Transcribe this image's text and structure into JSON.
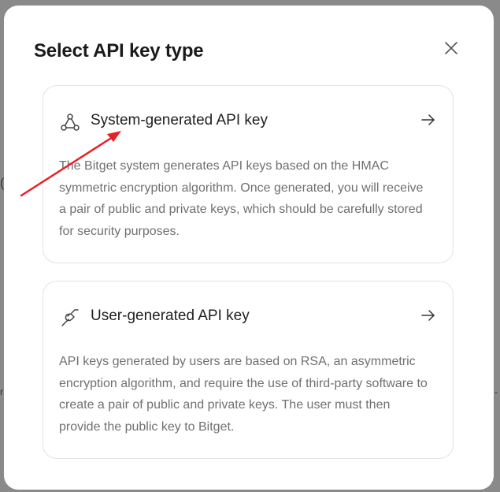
{
  "modal": {
    "title": "Select API key type"
  },
  "cards": [
    {
      "title": "System-generated API key",
      "description": "The Bitget system generates API keys based on the HMAC symmetric encryption algorithm. Once generated, you will receive a pair of public and private keys, which should be carefully stored for security purposes.",
      "icon": "webhook-icon"
    },
    {
      "title": "User-generated API key",
      "description": "API keys generated by users are based on RSA, an asymmetric encryption algorithm, and require the use of third-party software to create a pair of public and private keys. The user must then provide the public key to Bitget.",
      "icon": "plug-link-icon"
    }
  ],
  "annotation": {
    "color": "#e8202a"
  }
}
